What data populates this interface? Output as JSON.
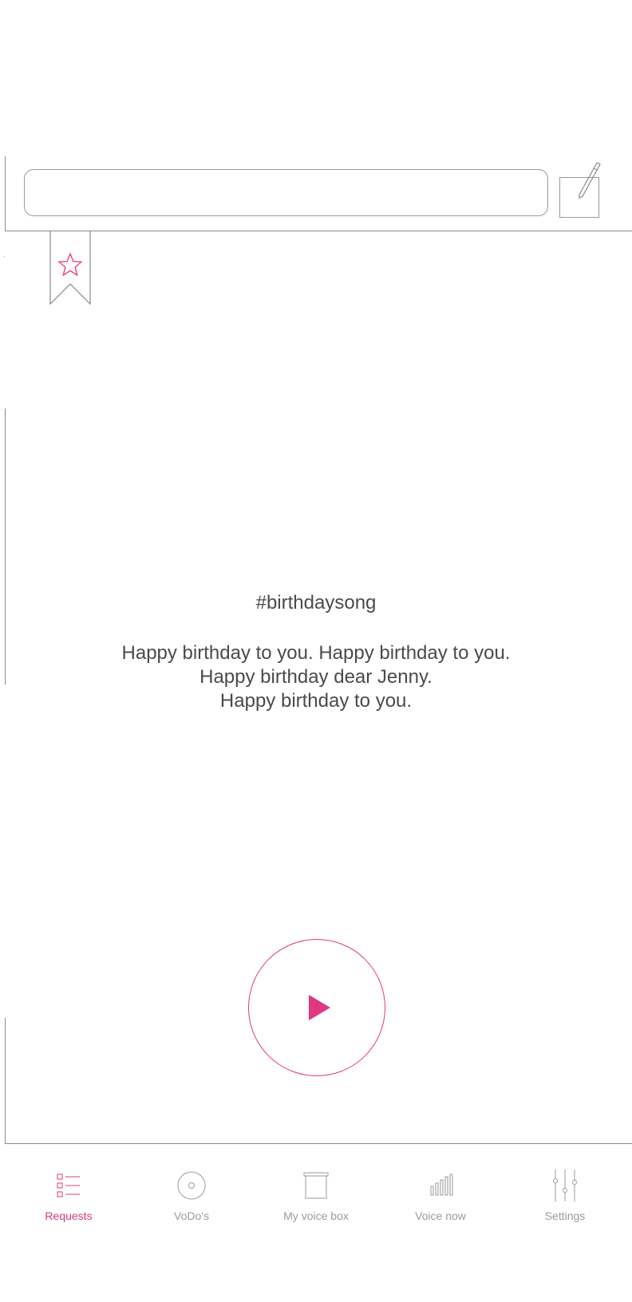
{
  "header": {
    "search_value": "",
    "search_placeholder": ""
  },
  "content": {
    "hashtag": "#birthdaysong",
    "lyrics_lines": [
      "Happy birthday to you. Happy birthday to you.",
      "Happy birthday dear Jenny.",
      "Happy birthday to you."
    ]
  },
  "colors": {
    "accent": "#e0387f",
    "line": "#8a8a8a",
    "inactive": "#9a9a9a",
    "text": "#4a4a4a"
  },
  "icons": {
    "bookmark": "star-bookmark-icon",
    "edit": "pencil-icon",
    "play": "play-icon"
  },
  "nav": {
    "items": [
      {
        "label": "Requests",
        "icon": "list-icon",
        "active": true
      },
      {
        "label": "VoDo's",
        "icon": "disc-icon",
        "active": false
      },
      {
        "label": "My voice box",
        "icon": "box-icon",
        "active": false
      },
      {
        "label": "Voice now",
        "icon": "bars-icon",
        "active": false
      },
      {
        "label": "Settings",
        "icon": "sliders-icon",
        "active": false
      }
    ]
  }
}
